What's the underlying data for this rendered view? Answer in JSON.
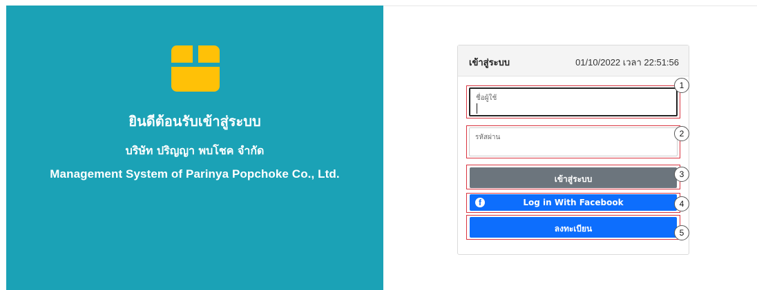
{
  "branding": {
    "welcome_title": "ยินดีต้อนรับเข้าสู่ระบบ",
    "company_name_th": "บริษัท ปริญญา พบโชค จำกัด",
    "company_name_en": "Management System of Parinya Popchoke Co., Ltd.",
    "logo_icon": "box-icon",
    "panel_color": "#1ba2b6",
    "icon_color": "#ffc107"
  },
  "login_card": {
    "title": "เข้าสู่ระบบ",
    "datetime": "01/10/2022 เวลา 22:51:56",
    "fields": {
      "username": {
        "placeholder": "ชื่อผู้ใช้",
        "value": ""
      },
      "password": {
        "placeholder": "รหัสผ่าน",
        "value": ""
      }
    },
    "buttons": {
      "login": "เข้าสู่ระบบ",
      "facebook": "Log in With Facebook",
      "register": "ลงทะเบียน"
    },
    "facebook_icon": "facebook-icon",
    "colors": {
      "login_button": "#6c757d",
      "primary_button": "#0d6efd",
      "annotation_frame": "#d9333f"
    }
  },
  "annotations": [
    "1",
    "2",
    "3",
    "4",
    "5"
  ]
}
